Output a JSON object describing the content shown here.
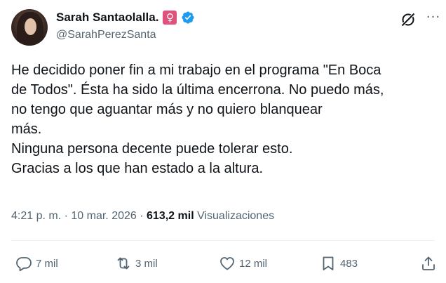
{
  "author": {
    "display_name": "Sarah Santaolalla.",
    "gender_emoji": "♀",
    "handle": "@SarahPerezSanta"
  },
  "tweet": {
    "lines": [
      "He decidido poner fin a mi trabajo en el programa \"En Boca",
      "de Todos\". Ésta ha sido la última encerrona. No puedo más,",
      "no tengo que aguantar más y no quiero blanquear",
      "más.",
      "Ninguna persona decente puede tolerar esto.",
      "Gracias a los que han estado a la altura."
    ]
  },
  "meta": {
    "time": "4:21 p. m.",
    "separator1": "·",
    "date": "10 mar. 2026",
    "separator2": "·",
    "views_count": "613,2 mil",
    "views_label": "Visualizaciones"
  },
  "actions": {
    "replies": "7 mil",
    "reposts": "3 mil",
    "likes": "12 mil",
    "bookmarks": "483"
  },
  "icons": {
    "verified": "verified-badge-icon",
    "grok": "grok-icon",
    "more": "more-icon",
    "reply": "reply-icon",
    "repost": "repost-icon",
    "like": "heart-icon",
    "bookmark": "bookmark-icon",
    "share": "share-icon"
  },
  "colors": {
    "verified_blue": "#1d9bf0",
    "gender_badge": "#e0517b",
    "secondary_text": "#536471",
    "primary_text": "#0f1419"
  }
}
